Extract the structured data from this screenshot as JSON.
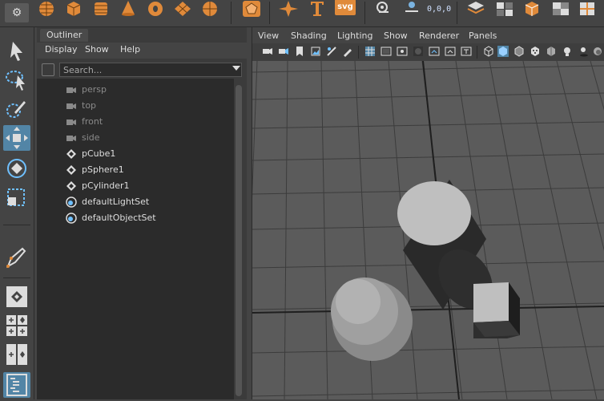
{
  "shelf": {
    "settings_icon": "gear-icon",
    "svg_label": "svg",
    "coord_label": "0,0,0",
    "accent": "#e08a3a"
  },
  "toolbox": {
    "tools": [
      "select-tool",
      "lasso-tool",
      "paint-select-tool",
      "move-tool",
      "rotate-tool",
      "scale-tool",
      "quick-sketch-tool",
      "single-view-layout",
      "four-view-layout",
      "two-view-layout",
      "outliner-layout"
    ],
    "active_tool": "move-tool",
    "active_color": "#5285a6"
  },
  "outliner": {
    "tab": "Outliner",
    "menu": [
      "Display",
      "Show",
      "Help"
    ],
    "search_placeholder": "Search...",
    "items": [
      {
        "label": "persp",
        "icon": "camera-icon",
        "dim": true
      },
      {
        "label": "top",
        "icon": "camera-icon",
        "dim": true
      },
      {
        "label": "front",
        "icon": "camera-icon",
        "dim": true
      },
      {
        "label": "side",
        "icon": "camera-icon",
        "dim": true
      },
      {
        "label": "pCube1",
        "icon": "mesh-icon",
        "dim": false
      },
      {
        "label": "pSphere1",
        "icon": "mesh-icon",
        "dim": false
      },
      {
        "label": "pCylinder1",
        "icon": "mesh-icon",
        "dim": false
      },
      {
        "label": "defaultLightSet",
        "icon": "set-icon",
        "dim": false
      },
      {
        "label": "defaultObjectSet",
        "icon": "set-icon",
        "dim": false
      }
    ]
  },
  "viewport": {
    "menu": [
      "View",
      "Shading",
      "Lighting",
      "Show",
      "Renderer",
      "Panels"
    ],
    "background": "#5a5a5a",
    "objects": [
      "cylinder",
      "sphere",
      "cube"
    ]
  }
}
